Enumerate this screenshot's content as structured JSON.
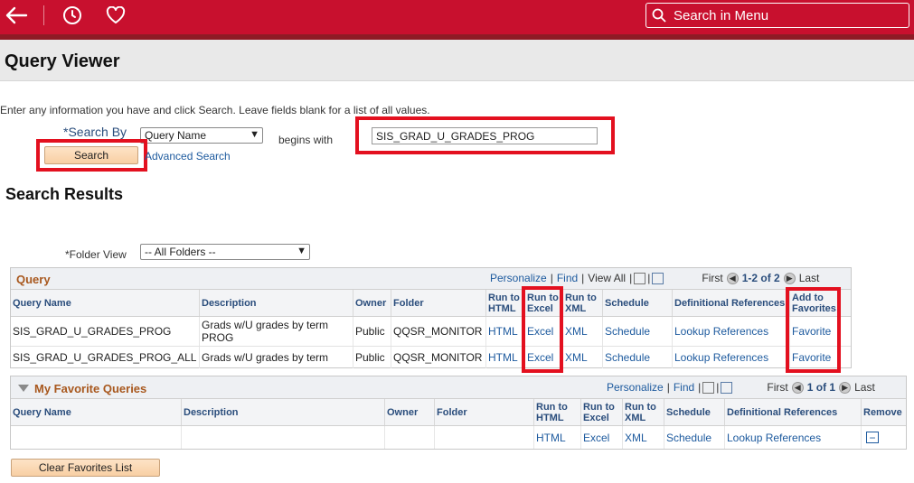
{
  "menu_search": {
    "placeholder": "Search in Menu"
  },
  "page_title": "Query Viewer",
  "instructions": "Enter any information you have and click Search. Leave fields blank for a list of all values.",
  "search_by": {
    "label": "*Search By",
    "selected": "Query Name",
    "operator": "begins with",
    "value": "SIS_GRAD_U_GRADES_PROG"
  },
  "search_button": "Search",
  "advanced_search": "Advanced Search",
  "results_title": "Search Results",
  "folder_view": {
    "label": "*Folder View",
    "selected": "-- All Folders --"
  },
  "query_grid": {
    "title": "Query",
    "personalize": "Personalize",
    "find": "Find",
    "view_all": "View All",
    "first": "First",
    "range": "1-2 of 2",
    "last": "Last",
    "columns": [
      "Query Name",
      "Description",
      "Owner",
      "Folder",
      "Run to HTML",
      "Run to Excel",
      "Run to XML",
      "Schedule",
      "Definitional References",
      "Add to Favorites"
    ],
    "rows": [
      {
        "name": "SIS_GRAD_U_GRADES_PROG",
        "description": "Grads w/U grades by term PROG",
        "owner": "Public",
        "folder": "QQSR_MONITOR",
        "html": "HTML",
        "excel": "Excel",
        "xml": "XML",
        "schedule": "Schedule",
        "refs": "Lookup References",
        "fav": "Favorite"
      },
      {
        "name": "SIS_GRAD_U_GRADES_PROG_ALL",
        "description": "Grads w/U grades by term",
        "owner": "Public",
        "folder": "QQSR_MONITOR",
        "html": "HTML",
        "excel": "Excel",
        "xml": "XML",
        "schedule": "Schedule",
        "refs": "Lookup References",
        "fav": "Favorite"
      }
    ]
  },
  "favorites_grid": {
    "title": "My Favorite Queries",
    "personalize": "Personalize",
    "find": "Find",
    "first": "First",
    "range": "1 of 1",
    "last": "Last",
    "columns": [
      "Query Name",
      "Description",
      "Owner",
      "Folder",
      "Run to HTML",
      "Run to Excel",
      "Run to XML",
      "Schedule",
      "Definitional References",
      "Remove"
    ],
    "row": {
      "html": "HTML",
      "excel": "Excel",
      "xml": "XML",
      "schedule": "Schedule",
      "refs": "Lookup References"
    }
  },
  "clear_favorites": "Clear Favorites List",
  "colors": {
    "header_red": "#c8102e",
    "highlight_red": "#e3101f",
    "link_blue": "#1d5a9e"
  }
}
